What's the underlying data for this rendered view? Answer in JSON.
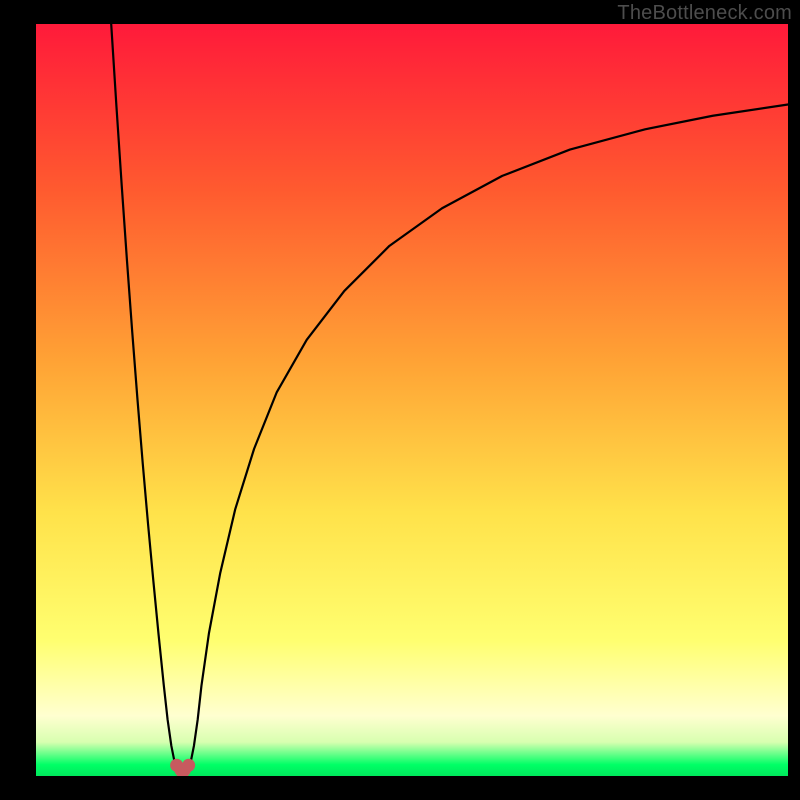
{
  "watermark": "TheBottleneck.com",
  "colors": {
    "black": "#000000",
    "gradient_top": "#ff1a3a",
    "gradient_mid_upper": "#ff7a2a",
    "gradient_mid": "#ffd040",
    "gradient_lower": "#ffff66",
    "gradient_pale": "#ffffcc",
    "gradient_bottom": "#00ff66",
    "curve": "#000000",
    "marker_fill": "#c75a5f",
    "marker_stroke": "#b24b50"
  },
  "layout": {
    "outer_w": 800,
    "outer_h": 800,
    "inner_x": 36,
    "inner_y": 24,
    "inner_w": 752,
    "inner_h": 752
  },
  "chart_data": {
    "type": "line",
    "title": "",
    "xlabel": "",
    "ylabel": "",
    "xlim": [
      0,
      100
    ],
    "ylim": [
      0,
      100
    ],
    "grid": false,
    "legend": false,
    "note": "Two monotone curve segments meeting at a cusp near x≈19, y≈0; values estimated from pixel positions on an unlabeled 0–100 axis.",
    "series": [
      {
        "name": "left-branch",
        "x": [
          10.0,
          10.7,
          11.4,
          12.1,
          12.8,
          13.5,
          14.2,
          14.9,
          15.6,
          16.3,
          17.0,
          17.5,
          18.0,
          18.5
        ],
        "values": [
          100.0,
          89.0,
          78.5,
          68.5,
          59.0,
          50.0,
          41.5,
          33.5,
          26.0,
          18.8,
          12.0,
          7.5,
          4.0,
          1.5
        ]
      },
      {
        "name": "right-branch",
        "x": [
          20.5,
          21.0,
          21.5,
          22.0,
          23.0,
          24.5,
          26.5,
          29.0,
          32.0,
          36.0,
          41.0,
          47.0,
          54.0,
          62.0,
          71.0,
          81.0,
          90.0,
          100.0
        ],
        "values": [
          1.5,
          4.0,
          7.5,
          12.0,
          19.0,
          27.0,
          35.5,
          43.5,
          51.0,
          58.0,
          64.5,
          70.5,
          75.5,
          79.8,
          83.3,
          86.0,
          87.8,
          89.3
        ]
      }
    ],
    "markers": [
      {
        "name": "cusp-left",
        "x": 18.7,
        "y": 0.9
      },
      {
        "name": "cusp-mid",
        "x": 19.5,
        "y": 0.0
      },
      {
        "name": "cusp-right",
        "x": 20.3,
        "y": 0.9
      }
    ],
    "gradient_stops": [
      {
        "offset": 0.0,
        "color": "#ff1a3a"
      },
      {
        "offset": 0.22,
        "color": "#ff5a2f"
      },
      {
        "offset": 0.45,
        "color": "#ffa335"
      },
      {
        "offset": 0.65,
        "color": "#ffe24a"
      },
      {
        "offset": 0.82,
        "color": "#ffff70"
      },
      {
        "offset": 0.92,
        "color": "#ffffd0"
      },
      {
        "offset": 0.955,
        "color": "#d8ffb0"
      },
      {
        "offset": 0.985,
        "color": "#00ff66"
      },
      {
        "offset": 1.0,
        "color": "#00e85c"
      }
    ]
  }
}
